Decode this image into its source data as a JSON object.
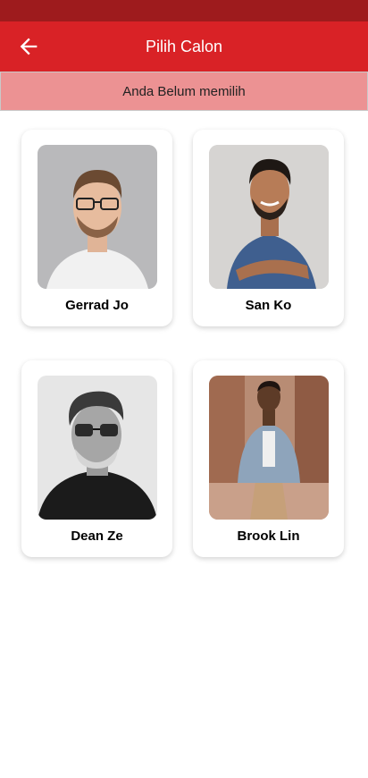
{
  "app_bar": {
    "title": "Pilih Calon",
    "back_icon": "arrow-left-icon",
    "color": "#d92226",
    "status_bar_color": "#9e1b1d"
  },
  "notice": {
    "text": "Anda Belum memilih",
    "color": "#ec9293"
  },
  "candidates": [
    {
      "name": "Gerrad Jo"
    },
    {
      "name": "San Ko"
    },
    {
      "name": "Dean Ze"
    },
    {
      "name": "Brook Lin"
    }
  ]
}
